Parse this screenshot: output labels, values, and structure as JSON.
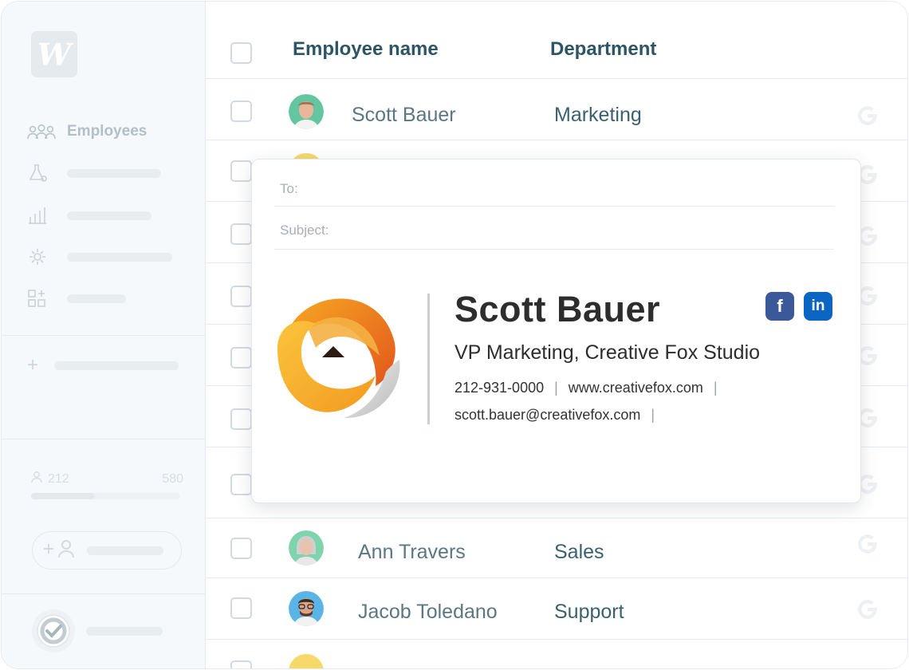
{
  "sidebar": {
    "logo_letter": "W",
    "nav_label": "Employees",
    "usage": {
      "current": "212",
      "limit": "580",
      "fill_fraction": 0.42
    }
  },
  "table": {
    "headers": {
      "name": "Employee name",
      "department": "Department"
    },
    "rows": [
      {
        "name": "Scott Bauer",
        "department": "Marketing"
      },
      {
        "name": "Ann Travers",
        "department": "Sales"
      },
      {
        "name": "Jacob Toledano",
        "department": "Support"
      }
    ]
  },
  "email": {
    "to_label": "To:",
    "subject_label": "Subject:",
    "signature": {
      "name": "Scott Bauer",
      "title": "VP Marketing, Creative Fox Studio",
      "phone": "212-931-0000",
      "website": "www.creativefox.com",
      "email": "scott.bauer@creativefox.com",
      "separator": "|",
      "social": {
        "facebook": "f",
        "linkedin": "in"
      }
    }
  },
  "colors": {
    "header_text": "#2c5566",
    "facebook": "#3b5998",
    "linkedin": "#0a66c2",
    "logo_orange": "#f08a1c",
    "logo_yellow": "#f7b733"
  }
}
